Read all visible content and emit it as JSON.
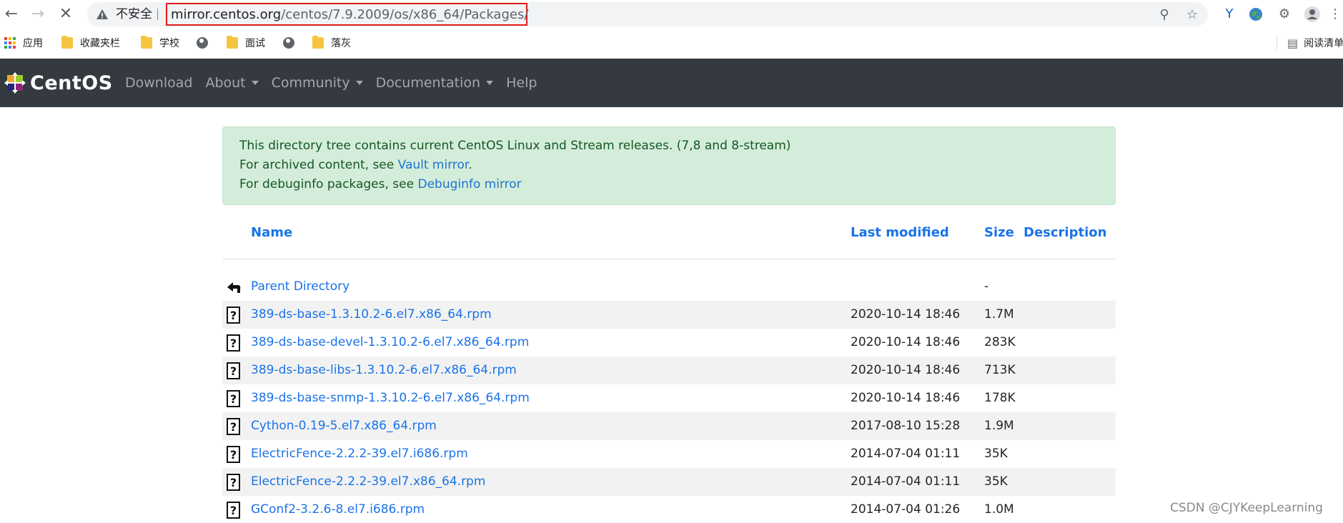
{
  "browser": {
    "insecure_label": "不安全",
    "url_host": "mirror.centos.org",
    "url_path": "/centos/7.9.2009/os/x86_64/Packages/",
    "bookmarks": [
      {
        "label": "应用",
        "icon": "apps-icon"
      },
      {
        "label": "收藏夹栏",
        "icon": "folder-icon"
      },
      {
        "label": "学校",
        "icon": "folder-icon"
      },
      {
        "label": "",
        "icon": "globe-icon"
      },
      {
        "label": "面试",
        "icon": "folder-icon"
      },
      {
        "label": "",
        "icon": "globe-icon"
      },
      {
        "label": "落灰",
        "icon": "folder-icon"
      }
    ],
    "reading_list": "阅读清单"
  },
  "site": {
    "brand": "CentOS",
    "nav": [
      {
        "label": "Download",
        "dropdown": false
      },
      {
        "label": "About",
        "dropdown": true
      },
      {
        "label": "Community",
        "dropdown": true
      },
      {
        "label": "Documentation",
        "dropdown": true
      },
      {
        "label": "Help",
        "dropdown": false
      }
    ]
  },
  "alert": {
    "line1": "This directory tree contains current CentOS Linux and Stream releases. (7,8 and 8-stream)",
    "line2_prefix": "For archived content, see ",
    "line2_link": "Vault mirror",
    "line2_suffix": ".",
    "line3_prefix": "For debuginfo packages, see ",
    "line3_link": "Debuginfo mirror"
  },
  "table": {
    "headers": {
      "name": "Name",
      "last_modified": "Last modified",
      "size": "Size",
      "description": "Description"
    },
    "rows": [
      {
        "name": "Parent Directory",
        "date": "",
        "size": "-",
        "icon": "back-arrow-icon"
      },
      {
        "name": "389-ds-base-1.3.10.2-6.el7.x86_64.rpm",
        "date": "2020-10-14 18:46",
        "size": "1.7M",
        "icon": "unknown-file-icon"
      },
      {
        "name": "389-ds-base-devel-1.3.10.2-6.el7.x86_64.rpm",
        "date": "2020-10-14 18:46",
        "size": "283K",
        "icon": "unknown-file-icon"
      },
      {
        "name": "389-ds-base-libs-1.3.10.2-6.el7.x86_64.rpm",
        "date": "2020-10-14 18:46",
        "size": "713K",
        "icon": "unknown-file-icon"
      },
      {
        "name": "389-ds-base-snmp-1.3.10.2-6.el7.x86_64.rpm",
        "date": "2020-10-14 18:46",
        "size": "178K",
        "icon": "unknown-file-icon"
      },
      {
        "name": "Cython-0.19-5.el7.x86_64.rpm",
        "date": "2017-08-10 15:28",
        "size": "1.9M",
        "icon": "unknown-file-icon"
      },
      {
        "name": "ElectricFence-2.2.2-39.el7.i686.rpm",
        "date": "2014-07-04 01:11",
        "size": "35K",
        "icon": "unknown-file-icon"
      },
      {
        "name": "ElectricFence-2.2.2-39.el7.x86_64.rpm",
        "date": "2014-07-04 01:11",
        "size": "35K",
        "icon": "unknown-file-icon"
      },
      {
        "name": "GConf2-3.2.6-8.el7.i686.rpm",
        "date": "2014-07-04 01:26",
        "size": "1.0M",
        "icon": "unknown-file-icon"
      }
    ]
  },
  "watermark": "CSDN @CJYKeepLearning",
  "colors": {
    "navbar": "#343a40",
    "link": "#1a73e8",
    "alert_bg": "#d4edda",
    "url_highlight": "#e01c1c"
  }
}
